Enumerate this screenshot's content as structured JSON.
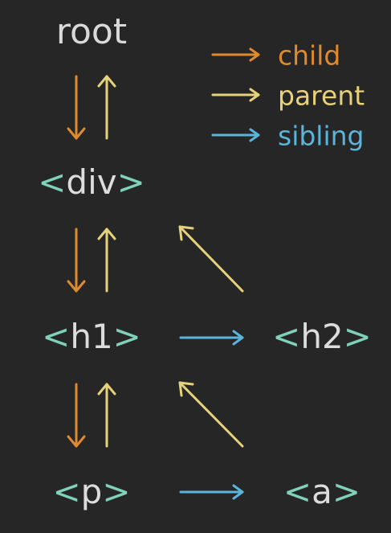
{
  "colors": {
    "background": "#262626",
    "child": "#e08a2e",
    "parent": "#e6d27a",
    "sibling": "#5bb4d9",
    "node_text": "#dcdcdc",
    "bracket": "#7fd1b9"
  },
  "legend": {
    "child_label": "child",
    "parent_label": "parent",
    "sibling_label": "sibling"
  },
  "nodes": {
    "root": "root",
    "div": "div",
    "h1": "h1",
    "h2": "h2",
    "p": "p",
    "a": "a"
  },
  "brackets": {
    "open": "<",
    "close": ">"
  }
}
